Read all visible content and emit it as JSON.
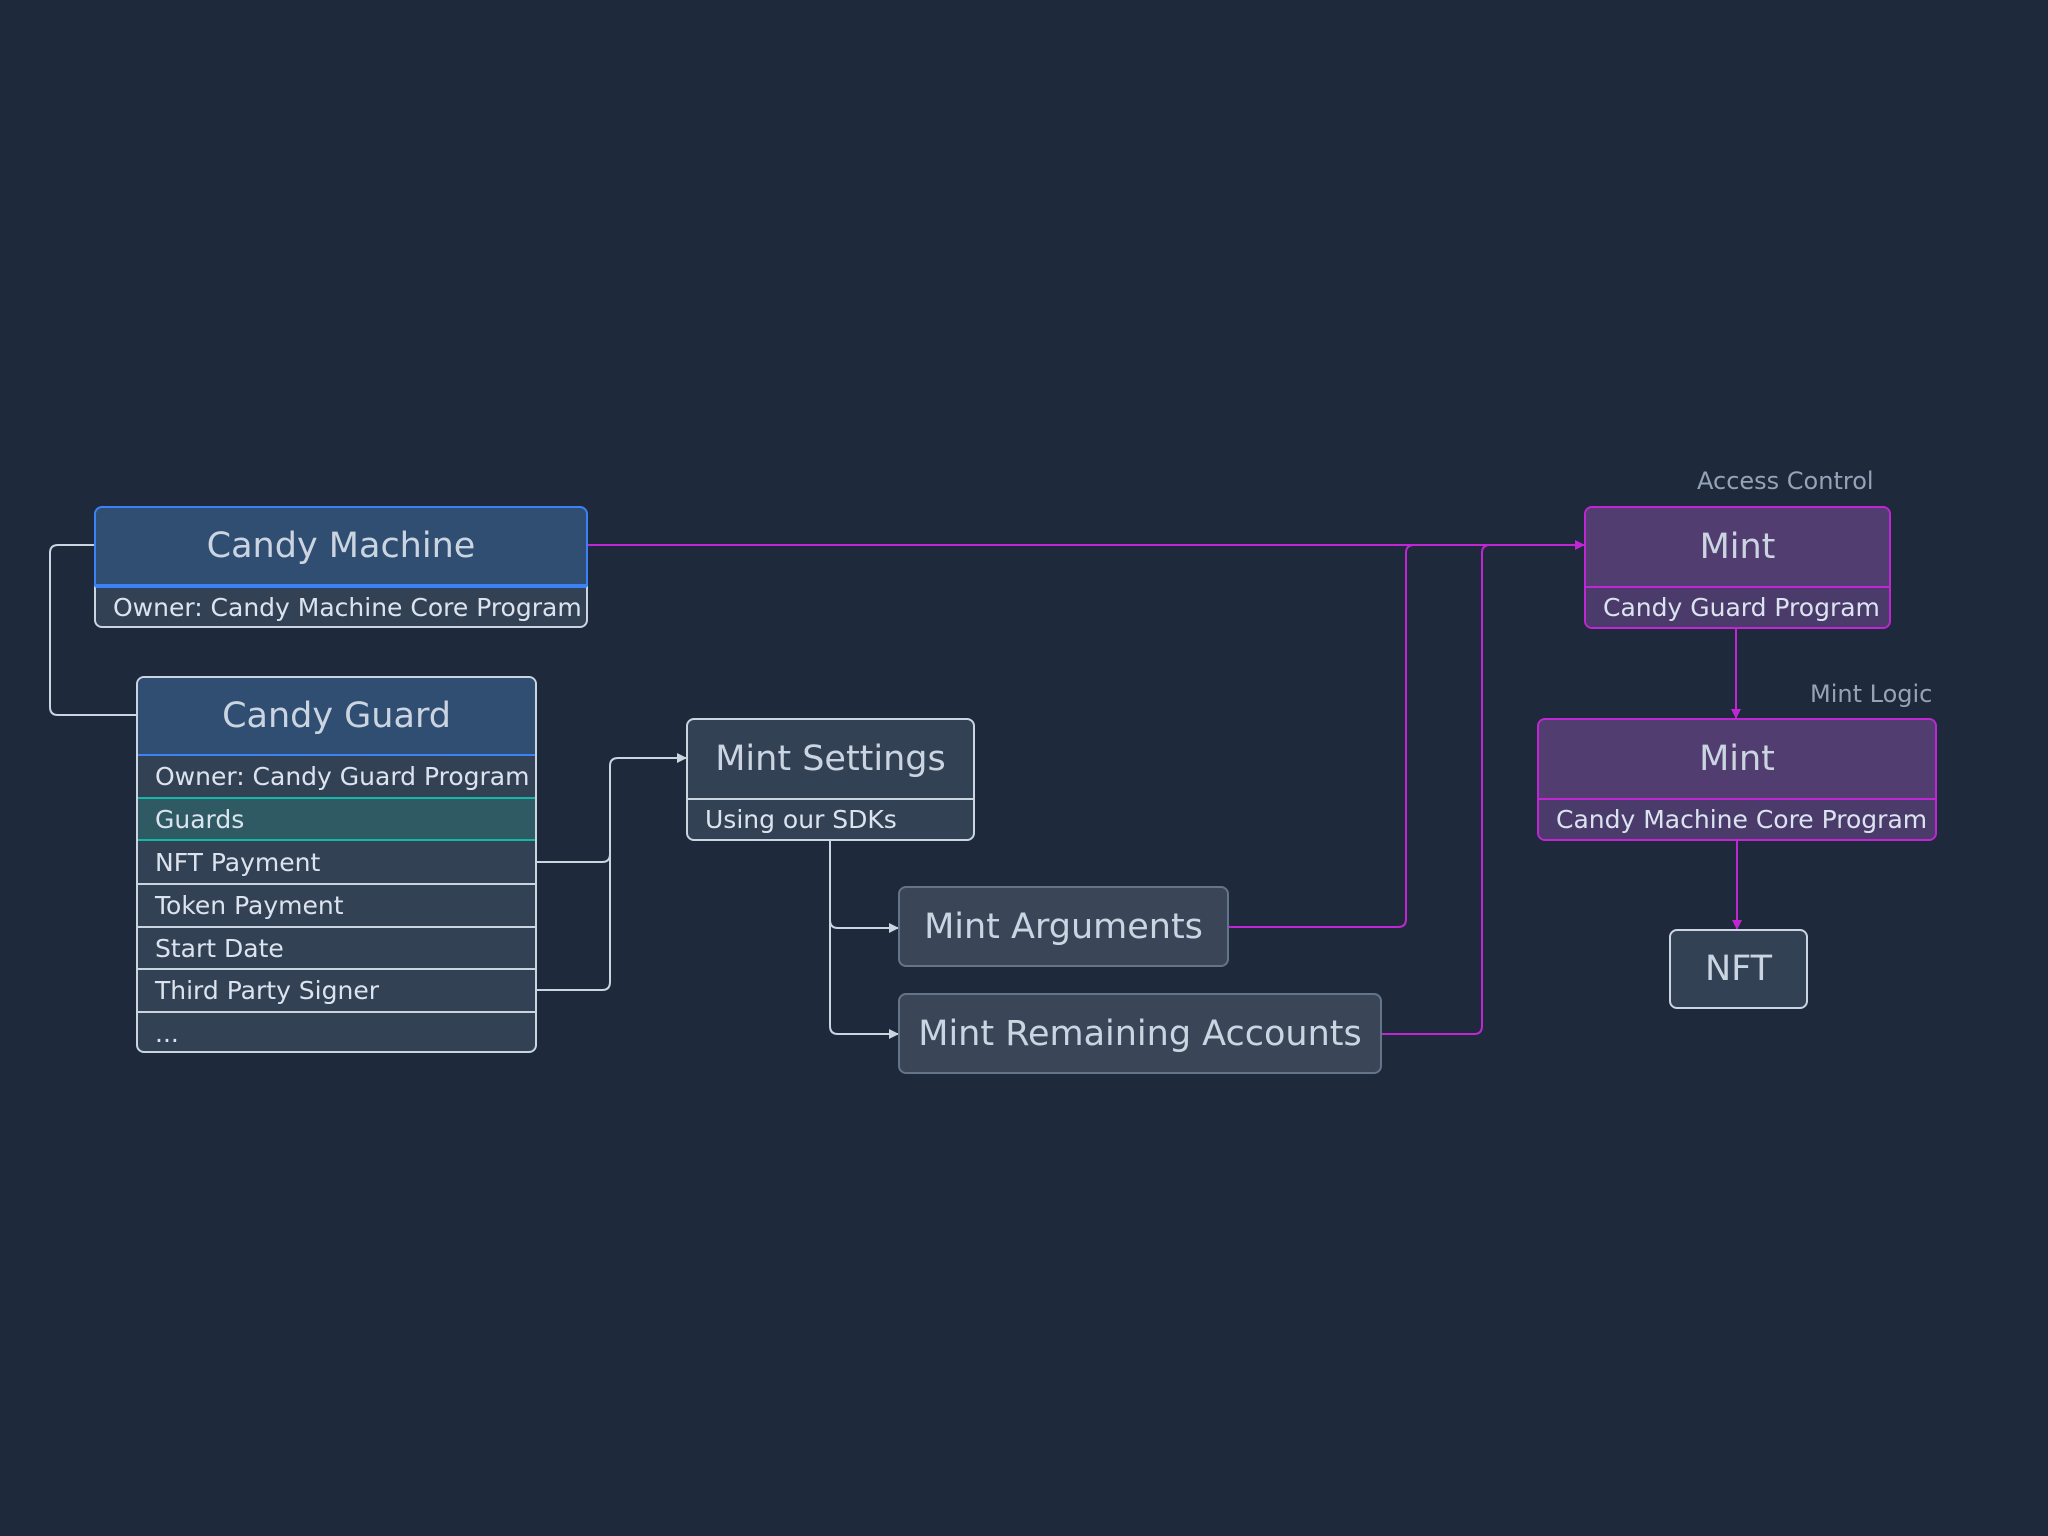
{
  "labels": {
    "access_control": "Access Control",
    "mint_logic": "Mint Logic"
  },
  "candy_machine": {
    "title": "Candy Machine",
    "owner": "Owner: Candy Machine Core Program"
  },
  "candy_guard": {
    "title": "Candy Guard",
    "owner": "Owner: Candy Guard Program",
    "rows": [
      "Guards",
      "NFT Payment",
      "Token Payment",
      "Start Date",
      "Third Party Signer",
      "..."
    ]
  },
  "mint_settings": {
    "title": "Mint Settings",
    "subtitle": "Using our SDKs"
  },
  "mint_arguments": {
    "title": "Mint Arguments"
  },
  "mint_remaining_accounts": {
    "title": "Mint Remaining Accounts"
  },
  "mint_access": {
    "title": "Mint",
    "subtitle": "Candy Guard Program"
  },
  "mint_logic": {
    "title": "Mint",
    "subtitle": "Candy Machine Core Program"
  },
  "nft": {
    "title": "NFT"
  },
  "colors": {
    "background": "#1e293b",
    "account_border": "#3b82f6",
    "program_border": "#c026d3",
    "guards_highlight": "#14b8a6",
    "connector_light": "#cbd5e1",
    "connector_purple": "#c026d3"
  }
}
